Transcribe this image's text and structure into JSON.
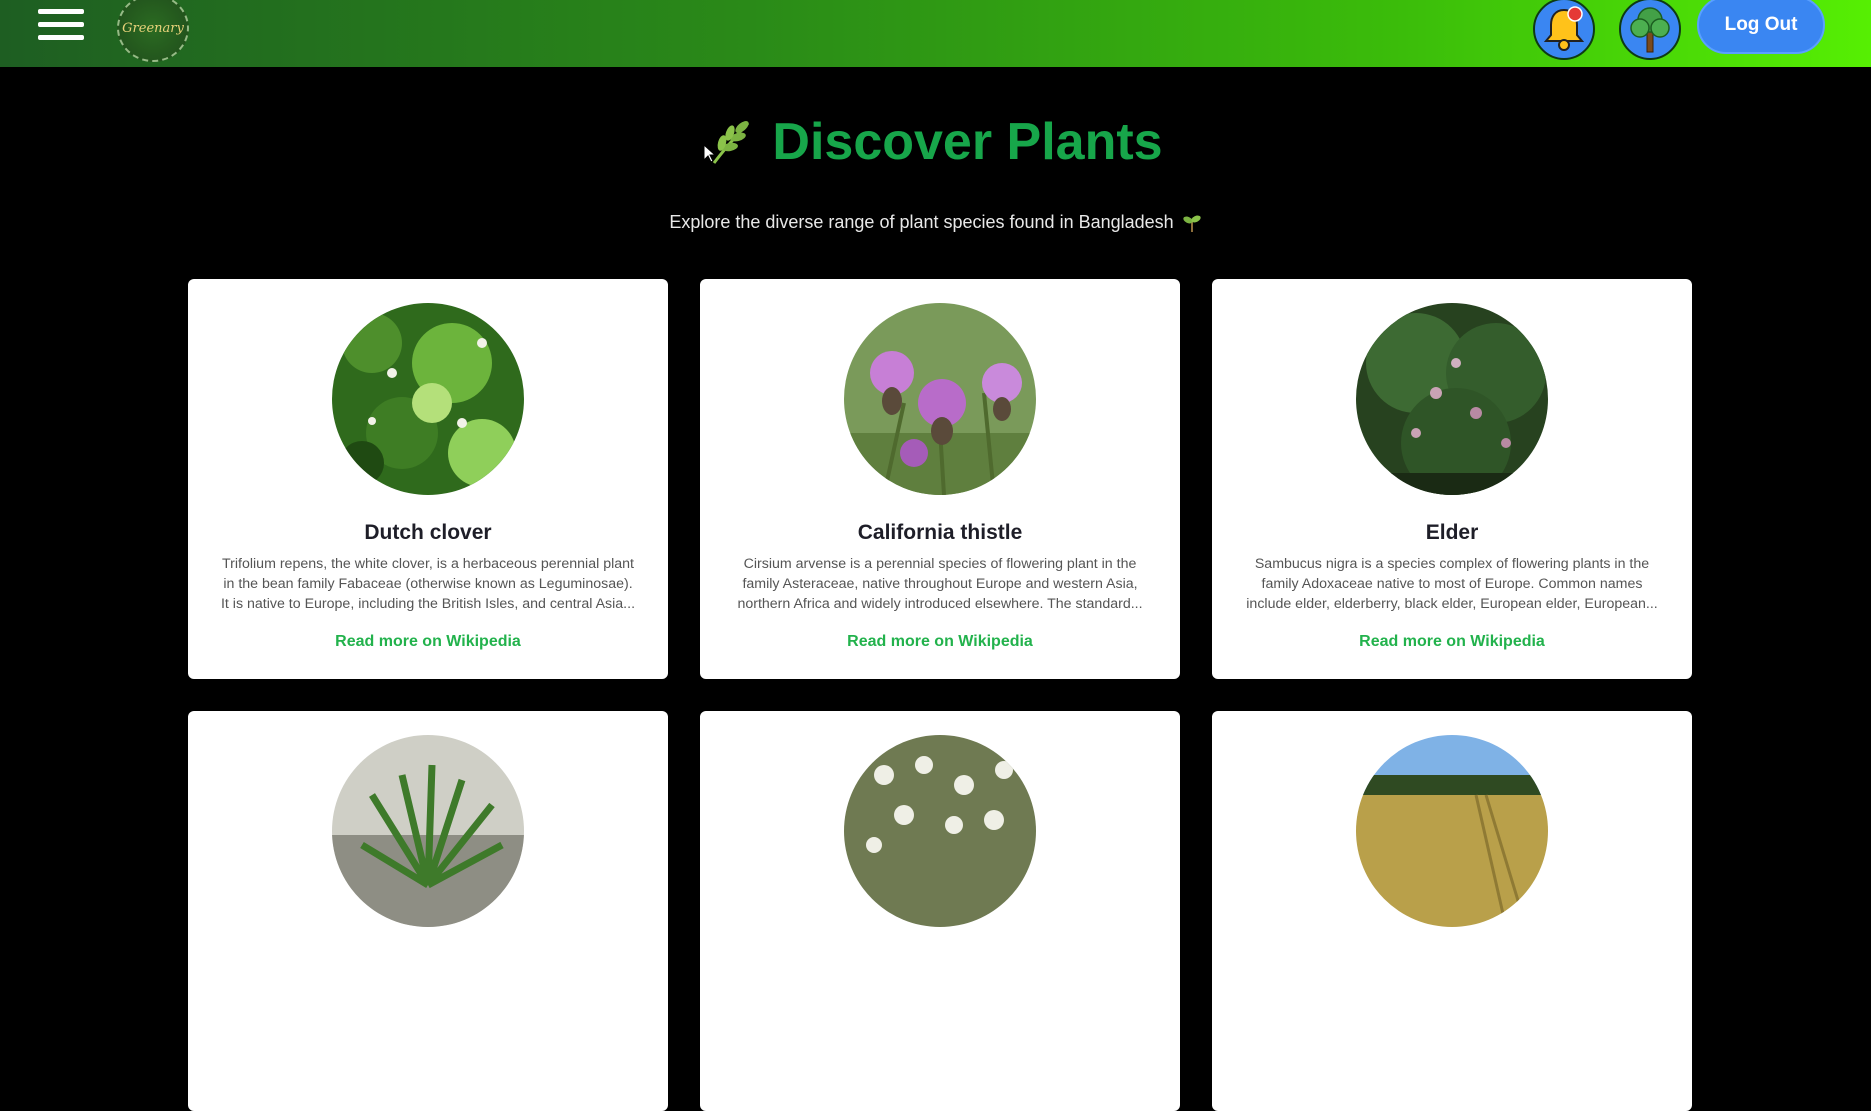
{
  "header": {
    "logo_text": "Greenary",
    "logout_label": "Log Out",
    "notification_icon": "bell-icon",
    "avatar_icon": "tree-icon"
  },
  "hero": {
    "title": "Discover Plants",
    "title_icon": "herb-icon",
    "subtitle": "Explore the diverse range of plant species found in Bangladesh",
    "subtitle_icon": "seedling-icon"
  },
  "colors": {
    "accent_green": "#17a64a",
    "link_green": "#22b24c",
    "button_blue": "#3a86f2"
  },
  "plants": [
    {
      "name": "Dutch clover",
      "description": "Trifolium repens, the white clover, is a herbaceous perennial plant in the bean family Fabaceae (otherwise known as Leguminosae). It is native to Europe, including the British Isles, and central Asia...",
      "link_label": "Read more on Wikipedia"
    },
    {
      "name": "California thistle",
      "description": "Cirsium arvense is a perennial species of flowering plant in the family Asteraceae, native throughout Europe and western Asia, northern Africa and widely introduced elsewhere. The standard...",
      "link_label": "Read more on Wikipedia"
    },
    {
      "name": "Elder",
      "description": "Sambucus nigra is a species complex of flowering plants in the family Adoxaceae native to most of Europe. Common names include elder, elderberry, black elder, European elder, European...",
      "link_label": "Read more on Wikipedia"
    },
    {
      "name": "",
      "description": "",
      "link_label": ""
    },
    {
      "name": "",
      "description": "",
      "link_label": ""
    },
    {
      "name": "",
      "description": "",
      "link_label": ""
    }
  ]
}
